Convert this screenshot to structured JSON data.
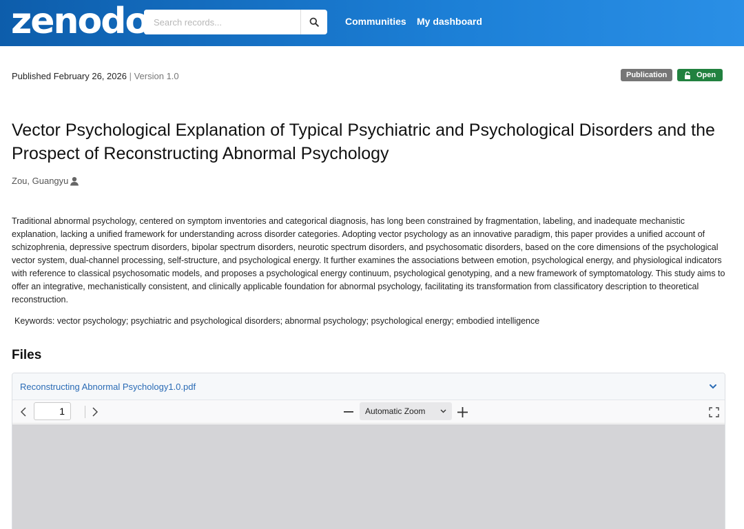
{
  "header": {
    "logo": "zenodo",
    "search_placeholder": "Search records...",
    "nav": [
      "Communities",
      "My dashboard"
    ]
  },
  "meta": {
    "published": "Published February 26, 2026",
    "separator": "|",
    "version": "Version 1.0",
    "badge_type": "Publication",
    "badge_access": "Open"
  },
  "record": {
    "title": "Vector Psychological Explanation of Typical Psychiatric and Psychological Disorders and the Prospect of Reconstructing Abnormal Psychology",
    "author": "Zou, Guangyu",
    "abstract": "Traditional abnormal psychology, centered on symptom inventories and categorical diagnosis, has long been constrained by fragmentation, labeling, and inadequate mechanistic explanation, lacking a unified framework for understanding across disorder categories. Adopting vector psychology as an innovative paradigm, this paper provides a unified account of schizophrenia, depressive spectrum disorders, bipolar spectrum disorders, neurotic spectrum disorders, and psychosomatic disorders, based on the core dimensions of the psychological vector system, dual-channel processing, self-structure, and psychological energy. It further examines the associations between emotion, psychological energy, and physiological indicators with reference to classical psychosomatic models, and proposes a psychological energy continuum, psychological genotyping, and a new framework of symptomatology. This study aims to offer an integrative, mechanistically consistent, and clinically applicable foundation for abnormal psychology, facilitating its transformation from classificatory description to theoretical reconstruction.",
    "keywords": "Keywords: vector psychology; psychiatric and psychological disorders; abnormal psychology; psychological energy; embodied intelligence"
  },
  "files": {
    "heading": "Files",
    "file_name": "Reconstructing Abnormal Psychology1.0.pdf",
    "viewer": {
      "page": "1",
      "zoom": "Automatic Zoom"
    }
  },
  "colors": {
    "header_start": "#0d5dab",
    "header_end": "#2a8fe6",
    "badge_publication": "#767676",
    "badge_open": "#21813f",
    "link": "#2a6bb5"
  },
  "icons": [
    "search-icon",
    "user-icon",
    "lock-open-icon",
    "chevron-down-icon",
    "chevron-left-icon",
    "chevron-right-icon",
    "minus-icon",
    "plus-icon",
    "fullscreen-icon"
  ]
}
